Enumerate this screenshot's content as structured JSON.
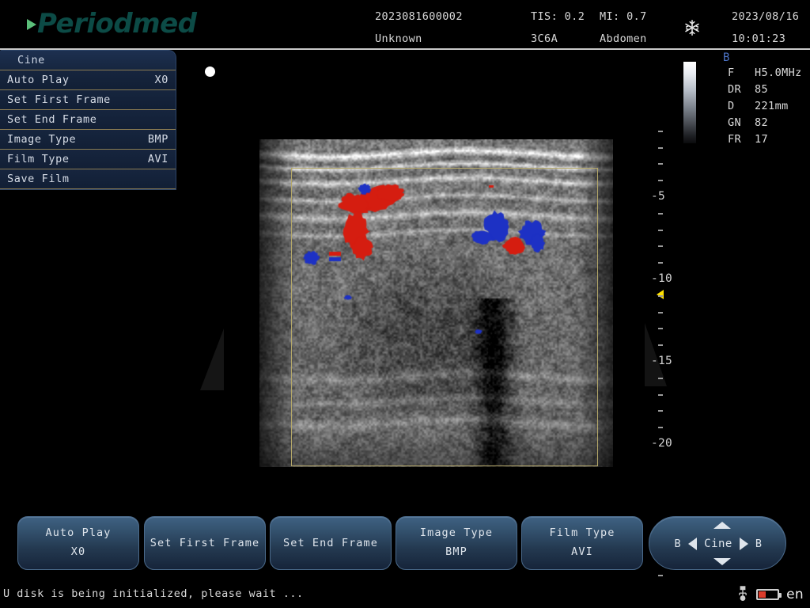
{
  "brand": {
    "name": "Periodmed"
  },
  "header": {
    "patient_id": "2023081600002",
    "patient_name": "Unknown",
    "tis": "TIS: 0.2",
    "mi": "MI: 0.7",
    "probe": "3C6A",
    "region": "Abdomen",
    "date": "2023/08/16",
    "time": "10:01:23",
    "freeze_icon": "snowflake-icon"
  },
  "cine_menu": {
    "title": "Cine",
    "items": [
      {
        "label": "Auto Play",
        "value": "X0"
      },
      {
        "label": "Set First Frame",
        "value": ""
      },
      {
        "label": "Set End Frame",
        "value": ""
      },
      {
        "label": "Image Type",
        "value": "BMP"
      },
      {
        "label": "Film Type",
        "value": "AVI"
      },
      {
        "label": "Save Film",
        "value": ""
      }
    ]
  },
  "imaging": {
    "mode": "B",
    "params": [
      {
        "key": "F",
        "value": "H5.0MHz"
      },
      {
        "key": "DR",
        "value": "85"
      },
      {
        "key": "D",
        "value": "221mm"
      },
      {
        "key": "GN",
        "value": "82"
      },
      {
        "key": "FR",
        "value": "17"
      }
    ],
    "depth_labels": [
      "-5",
      "-10",
      "-15",
      "-20"
    ],
    "depth_unit": "cm",
    "focus_marker": "focus-arrow",
    "color_doppler": {
      "red": "#d51d10",
      "blue": "#1d31c4"
    },
    "roi_border_color": "#b5a869"
  },
  "bottom_bar": {
    "buttons": [
      {
        "label": "Auto Play",
        "value": "X0"
      },
      {
        "label": "Set First Frame",
        "value": ""
      },
      {
        "label": "Set End Frame",
        "value": ""
      },
      {
        "label": "Image Type",
        "value": "BMP"
      },
      {
        "label": "Film Type",
        "value": "AVI"
      }
    ],
    "nav": {
      "left_mode": "B",
      "right_mode": "B",
      "center": "Cine"
    }
  },
  "status": {
    "message": "U disk is being initialized, please wait ...",
    "language": "en",
    "usb_icon": "usb-icon",
    "battery_icon": "battery-low-icon"
  }
}
